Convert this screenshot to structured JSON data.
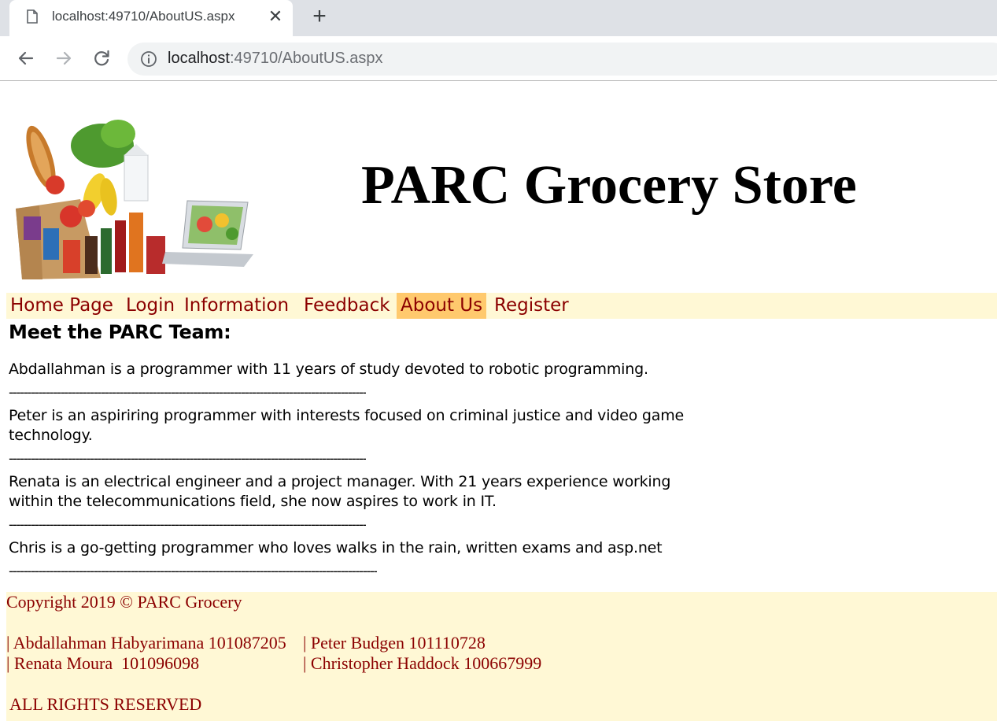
{
  "browser": {
    "tab_title": "localhost:49710/AboutUS.aspx",
    "url_host": "localhost",
    "url_rest": ":49710/AboutUS.aspx",
    "icons": [
      "page-icon",
      "close-icon",
      "plus-icon",
      "back-arrow-icon",
      "forward-arrow-icon",
      "reload-icon",
      "info-icon"
    ]
  },
  "site": {
    "title": "PARC Grocery Store"
  },
  "menu": {
    "items": [
      {
        "label": "Home Page"
      },
      {
        "label": "Login"
      },
      {
        "label": "Information"
      },
      {
        "label": "Feedback"
      },
      {
        "label": "About Us",
        "active": true
      },
      {
        "label": "Register"
      }
    ],
    "active_color": "#ffc96d",
    "bar_color": "#fff8d5",
    "text_color": "#8b0000"
  },
  "content": {
    "heading": "Meet the PARC Team:",
    "bios": [
      "Abdallahman is a programmer with 11 years of study devoted to robotic programming.",
      "Peter is an aspiriring programmer with interests focused on criminal justice and video game technology.",
      "Renata is an electrical engineer and a project manager. With 21 years experience working within the telecommunications field, she now aspires to work in IT.",
      "Chris is a go-getting programmer who loves walks in the rain, written exams and asp.net"
    ],
    "separator": "-------------------------------------------------------------------------------------------------",
    "separator_last": "----------------------------------------------------------------------------------------------------"
  },
  "footer": {
    "copyright": "Copyright 2019 © PARC Grocery",
    "row1_col1": "| Abdallahman Habyarimana 101087205",
    "row1_col2": "| Peter Budgen 101110728",
    "row2_col1": "| Renata Moura  101096098",
    "row2_col2": "| Christopher Haddock 100667999",
    "rights": "ALL RIGHTS RESERVED"
  }
}
